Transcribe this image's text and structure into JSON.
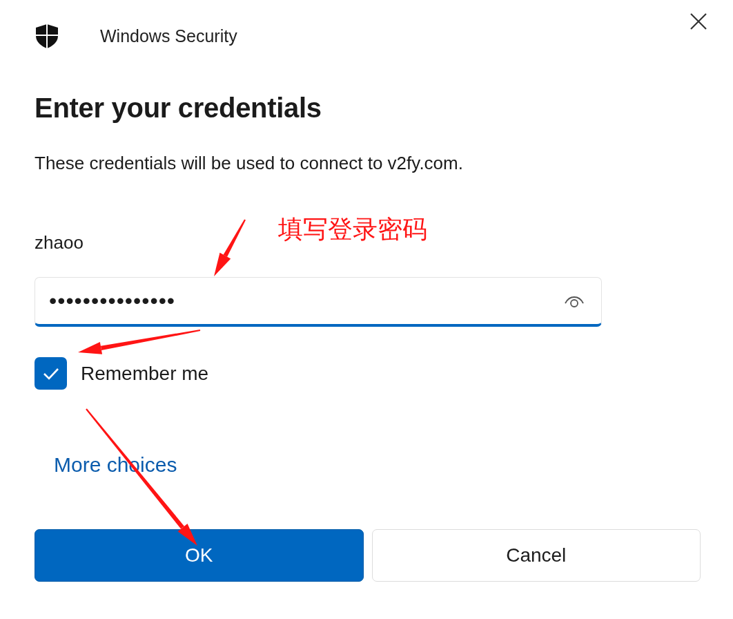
{
  "window": {
    "title": "Windows Security"
  },
  "heading": "Enter your credentials",
  "message": "These credentials will be used to connect to v2fy.com.",
  "username": "zhaoo",
  "password_field": {
    "value": "•••••••••••••••",
    "focused": true
  },
  "remember_me": {
    "label": "Remember me",
    "checked": true
  },
  "more_choices": "More choices",
  "buttons": [
    {
      "label": "OK",
      "kind": "primary"
    },
    {
      "label": "Cancel",
      "kind": "secondary"
    }
  ],
  "annotation": {
    "text": "填写登录密码"
  }
}
